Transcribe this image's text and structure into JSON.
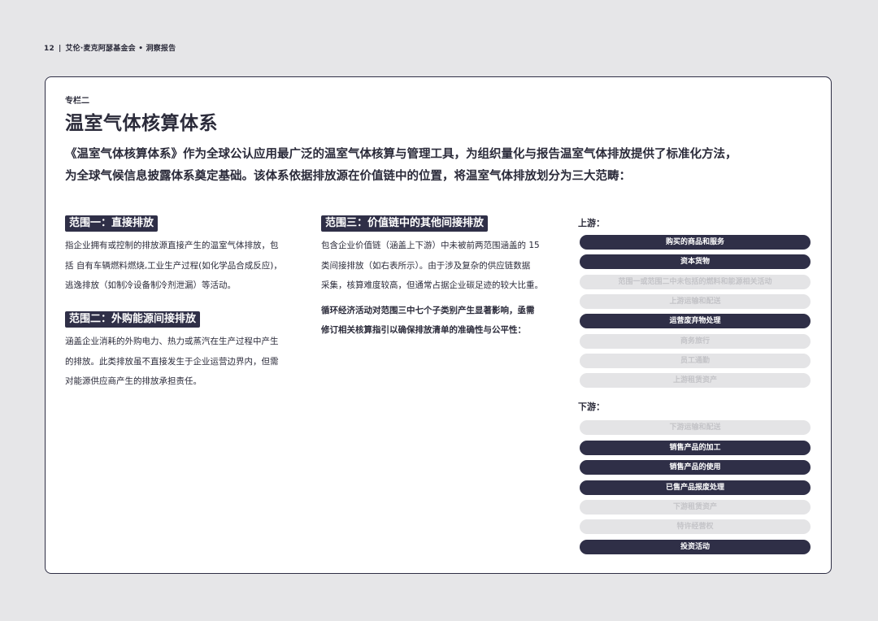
{
  "header": {
    "page_number": "12",
    "separator": "|",
    "publisher": "艾伦·麦克阿瑟基金会 • 洞察报告"
  },
  "box": {
    "kicker": "专栏二",
    "title": "温室气体核算体系",
    "intro_line1": "《温室气体核算体系》作为全球公认应用最广泛的温室气体核算与管理工具，为组织量化与报告温室气体排放提供了标准化方法，",
    "intro_line2": "为全球气候信息披露体系奠定基础。该体系依据排放源在价值链中的位置，将温室气体排放划分为三大范畴："
  },
  "scope1": {
    "heading": "范围一：直接排放",
    "line1": "指企业拥有或控制的排放源直接产生的温室气体排放，包",
    "line2": "括 自有车辆燃料燃烧,工业生产过程(如化学品合成反应)，",
    "line3": "逃逸排放（如制冷设备制冷剂泄漏）等活动。"
  },
  "scope2": {
    "heading": "范围二：外购能源间接排放",
    "line1": "涵盖企业消耗的外购电力、热力或蒸汽在生产过程中产生",
    "line2": "的排放。此类排放虽不直接发生于企业运营边界内，但需",
    "line3": "对能源供应商产生的排放承担责任。"
  },
  "scope3": {
    "heading": "范围三：价值链中的其他间接排放",
    "line1": "包含企业价值链（涵盖上下游）中未被前两范围涵盖的 15",
    "line2": "类间接排放（如右表所示）。由于涉及复杂的供应链数据",
    "line3": "采集，核算难度较高，但通常占据企业碳足迹的较大比重。",
    "note_line1": "循环经济活动对范围三中七个子类别产生显著影响，亟需",
    "note_line2": "修订相关核算指引以确保排放清单的准确性与公平性："
  },
  "upstream": {
    "label": "上游：",
    "items": [
      {
        "label": "购买的商品和服务",
        "highlighted": true
      },
      {
        "label": "资本货物",
        "highlighted": true
      },
      {
        "label": "范围一或范围二中未包括的燃料和能源相关活动",
        "highlighted": false
      },
      {
        "label": "上游运输和配送",
        "highlighted": false
      },
      {
        "label": "运营废弃物处理",
        "highlighted": true
      },
      {
        "label": "商务旅行",
        "highlighted": false
      },
      {
        "label": "员工通勤",
        "highlighted": false
      },
      {
        "label": "上游租赁资产",
        "highlighted": false
      }
    ]
  },
  "downstream": {
    "label": "下游：",
    "items": [
      {
        "label": "下游运输和配送",
        "highlighted": false
      },
      {
        "label": "销售产品的加工",
        "highlighted": true
      },
      {
        "label": "销售产品的使用",
        "highlighted": true
      },
      {
        "label": "已售产品报废处理",
        "highlighted": true
      },
      {
        "label": "下游租赁资产",
        "highlighted": false
      },
      {
        "label": "特许经营权",
        "highlighted": false
      },
      {
        "label": "投资活动",
        "highlighted": true
      }
    ]
  },
  "colors": {
    "highlight_pill": "#2f2f47",
    "muted_pill": "#e4e4e6",
    "page_background": "#e6e6e8"
  }
}
